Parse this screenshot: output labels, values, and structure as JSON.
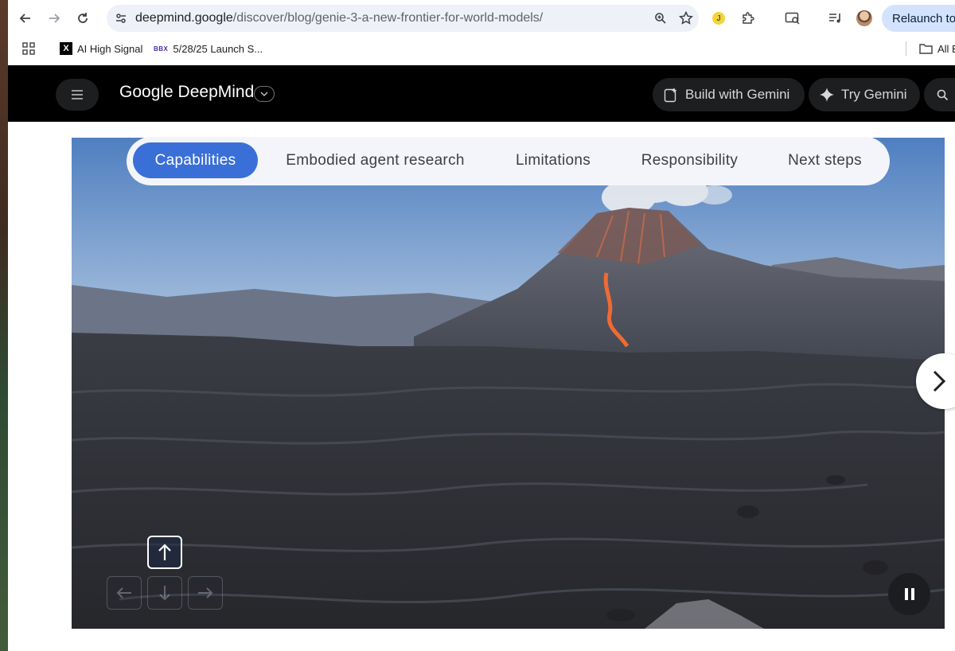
{
  "browser": {
    "url_host": "deepmind.google",
    "url_path": "/discover/blog/genie-3-a-new-frontier-for-world-models/",
    "relaunch_label": "Relaunch to u",
    "bookmarks": [
      {
        "label": "AI High Signal",
        "icon": "x-logo-icon"
      },
      {
        "label": "5/28/25 Launch S...",
        "icon": "bbx-logo-icon"
      }
    ],
    "all_bookmarks_label": "All B",
    "extension_badge": "J"
  },
  "site": {
    "logo": "Google DeepMind",
    "build_label": "Build with Gemini",
    "try_label": "Try Gemini"
  },
  "tabs": [
    {
      "label": "Capabilities",
      "active": true
    },
    {
      "label": "Embodied agent research",
      "active": false
    },
    {
      "label": "Limitations",
      "active": false
    },
    {
      "label": "Responsibility",
      "active": false
    },
    {
      "label": "Next steps",
      "active": false
    }
  ],
  "video": {
    "scene": "volcano-landscape",
    "playing": true,
    "active_key": "up-arrow"
  },
  "colors": {
    "accent": "#3a6fd8",
    "header_bg": "#000000",
    "omnibox_bg": "#eef1f8",
    "relaunch_bg": "#d3e3fd"
  }
}
